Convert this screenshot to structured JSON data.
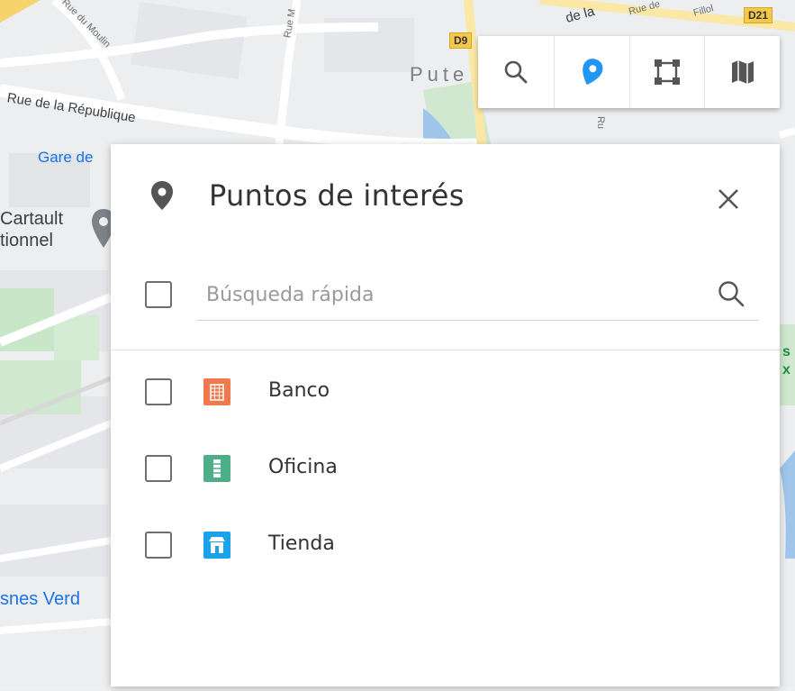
{
  "map": {
    "labels": {
      "rue_du_moulin": "Rue du Moulin",
      "rue_m": "Rue M",
      "rue_de_la_republique": "Rue de la République",
      "gare_de": "Gare de",
      "cartault": "Cartault",
      "tionnel": "tionnel",
      "snes_verd": "snes Verd",
      "pute": "Pute",
      "de_la": "de la",
      "rue_de": "Rue de",
      "fillol": "Fillol",
      "ru": "Ru",
      "s": "s",
      "x": "x"
    },
    "shields": {
      "d9": "D9",
      "d21": "D21"
    }
  },
  "toolbar": {
    "buttons": [
      {
        "icon": "search-icon",
        "active": false
      },
      {
        "icon": "poi-marker-icon",
        "active": true
      },
      {
        "icon": "polygon-select-icon",
        "active": false
      },
      {
        "icon": "map-layers-icon",
        "active": false
      }
    ],
    "active_color": "#2196f3",
    "icon_color": "#555555"
  },
  "panel": {
    "title": "Puntos de interés",
    "search": {
      "placeholder": "Búsqueda rápida",
      "value": ""
    },
    "items": [
      {
        "label": "Banco",
        "icon": "bank-icon",
        "color": "#f07a4e",
        "checked": false
      },
      {
        "label": "Oficina",
        "icon": "office-icon",
        "color": "#4caf8a",
        "checked": false
      },
      {
        "label": "Tienda",
        "icon": "shop-icon",
        "color": "#1aa3e8",
        "checked": false
      }
    ]
  }
}
